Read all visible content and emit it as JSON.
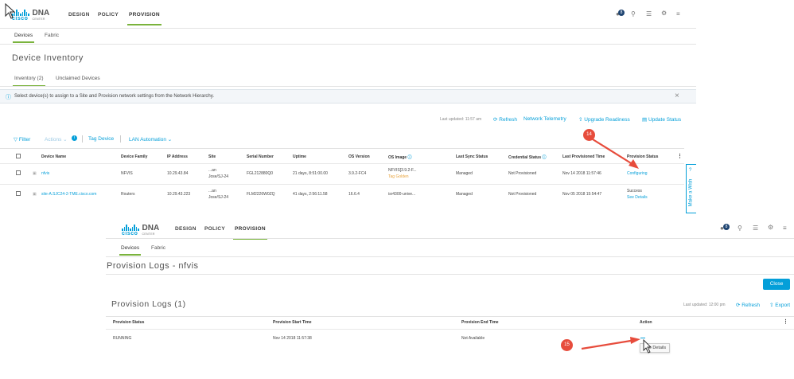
{
  "top": {
    "logo": {
      "cisco": "cisco",
      "dna": "DNA",
      "center": "CENTER"
    },
    "nav": [
      "DESIGN",
      "POLICY",
      "PROVISION"
    ],
    "notif_count": "8",
    "subnav": [
      "Devices",
      "Fabric"
    ],
    "page_title": "Device Inventory",
    "tabs": [
      "Inventory  (2)",
      "Unclaimed Devices"
    ],
    "info_message": "Select device(s) to assign to a Site and Provision network settings from the Network Hierarchy.",
    "last_updated": "Last updated: 11:57 am",
    "actions": [
      "Refresh",
      "Network Telemetry",
      "Upgrade Readiness",
      "Update Status"
    ],
    "toolbar": {
      "filter": "Filter",
      "actions": "Actions",
      "tag": "Tag Device",
      "lan": "LAN Automation"
    },
    "columns": [
      "Device Name",
      "Device Family",
      "IP Address",
      "Site",
      "Serial Number",
      "Uptime",
      "OS Version",
      "OS Image",
      "Last Sync Status",
      "Credential Status",
      "Last Provisioned Time",
      "Provision Status"
    ],
    "rows": [
      {
        "name": "nfvis",
        "family": "NFVIS",
        "ip": "10.29.43.84",
        "site1": "...an",
        "site2": "Jose/SJ-24",
        "serial": "FGL212880Q0",
        "uptime": "21 days, 8:51:00.00",
        "os": "3.9.2-FC4",
        "image1": "NFVIS[3.9.2-F...",
        "image2": "Tag Golden",
        "sync": "Managed",
        "cred": "Not Provisioned",
        "prov_time": "Nov 14 2018 11:57:46",
        "status1": "Configuring",
        "status2": ""
      },
      {
        "name": "site-A.SJC24-2-TME.cisco.com",
        "family": "Routers",
        "ip": "10.29.43.223",
        "site1": "...an",
        "site2": "Jose/SJ-24",
        "serial": "FLM2226W0ZQ",
        "uptime": "41 days, 2:56:11.58",
        "os": "16.6.4",
        "image1": "isr4300-unive...",
        "image2": "",
        "sync": "Managed",
        "cred": "Not Provisioned",
        "prov_time": "Nov 05 2018 15:54:47",
        "status1": "Success",
        "status2": "See Details"
      }
    ],
    "vtab": "Make a Wish",
    "marker": "14"
  },
  "bottom": {
    "logo": {
      "cisco": "cisco",
      "dna": "DNA",
      "center": "CENTER"
    },
    "nav": [
      "DESIGN",
      "POLICY",
      "PROVISION"
    ],
    "notif_count": "8",
    "subnav": [
      "Devices",
      "Fabric"
    ],
    "page_title": "Provision Logs - nfvis",
    "close": "Close",
    "section_title": "Provision Logs (1)",
    "last_updated": "Last updated: 12:00 pm",
    "refresh": "Refresh",
    "export": "Export",
    "columns": [
      "Provision Status",
      "Provision Start Time",
      "Provision End Time",
      "Action"
    ],
    "row": {
      "status": "RUNNING",
      "start": "Nov 14 2018 11:57:38",
      "end": "Not Available"
    },
    "tooltip": "See Details",
    "marker": "15"
  },
  "colors": {
    "accent": "#049fd9",
    "green": "#7ab33c",
    "marker": "#e74c3c"
  }
}
